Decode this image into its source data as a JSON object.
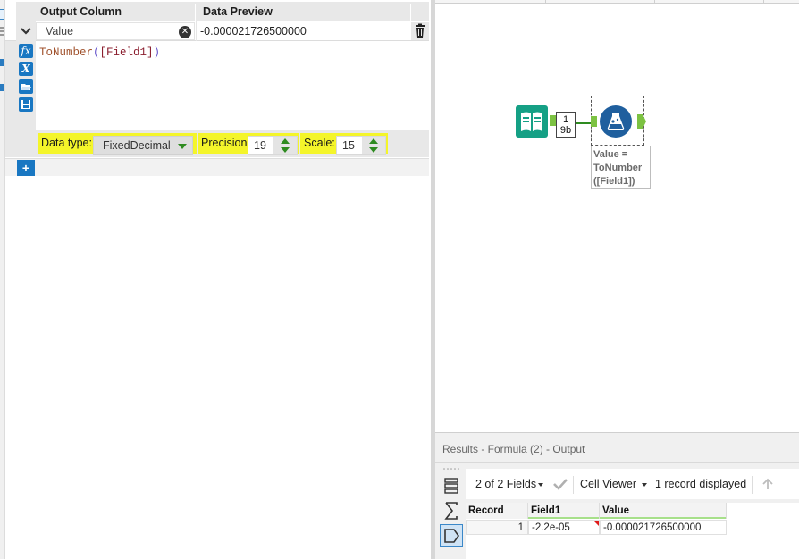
{
  "formula_config": {
    "columns": {
      "output": "Output Column",
      "preview": "Data Preview"
    },
    "row": {
      "output_column": "Value",
      "data_preview": "-0.000021726500000",
      "expression": {
        "fn": "ToNumber",
        "open": "(",
        "field": "[Field1]",
        "close": ")"
      }
    },
    "tool_icons": [
      "fx",
      "X"
    ],
    "type_bar": {
      "data_type_label": "Data type:",
      "data_type_value": "FixedDecimal",
      "precision_label": "Precision:",
      "precision_value": "19",
      "scale_label": "Scale:",
      "scale_value": "15"
    },
    "add_button": "+"
  },
  "canvas": {
    "connection_label": {
      "line1": "1",
      "line2": "9b"
    },
    "annotation": [
      "Value =",
      "ToNumber",
      "([Field1])"
    ]
  },
  "results": {
    "title": "Results - Formula (2) - Output",
    "toolbar": {
      "fields": "2 of 2 Fields",
      "cell_viewer": "Cell Viewer",
      "records": "1 record displayed"
    },
    "table": {
      "headers": [
        "Record",
        "Field1",
        "Value"
      ],
      "rows": [
        {
          "record": "1",
          "field1": "-2.2e-05",
          "value": "-0.000021726500000"
        }
      ]
    }
  },
  "colors": {
    "accent_blue": "#1977c2",
    "highlight_yellow": "#f4f52a",
    "anchor_green": "#7cc242",
    "input_teal": "#15a085",
    "formula_navy": "#1f5f9e"
  },
  "icons": [
    "chevron-down-icon",
    "clear-icon",
    "trash-icon",
    "fx-icon",
    "variable-icon",
    "folder-open-icon",
    "save-icon",
    "add-icon",
    "book-icon",
    "flask-icon",
    "rows-icon",
    "sigma-icon",
    "tag-icon",
    "check-icon",
    "arrow-up-icon"
  ]
}
